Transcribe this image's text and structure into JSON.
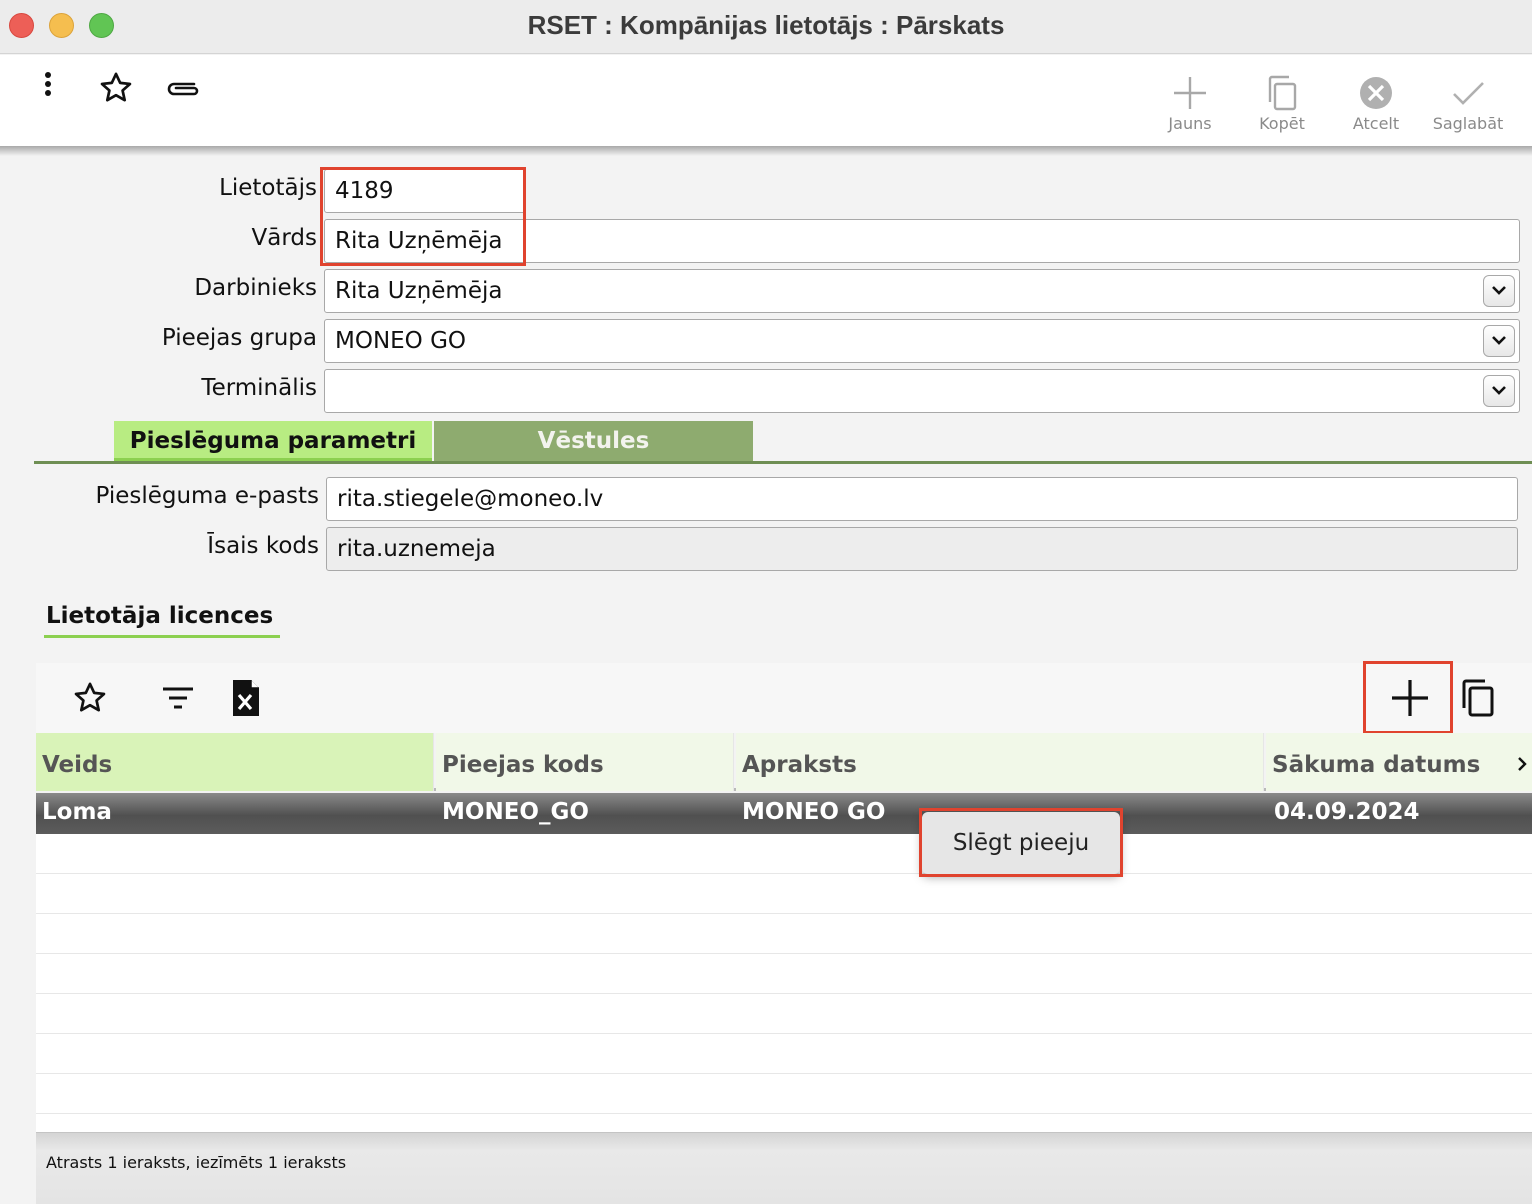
{
  "window": {
    "title": "RSET : Kompānijas lietotājs : Pārskats"
  },
  "toolbar": {
    "left_icons": [
      "more-vertical-icon",
      "star-icon",
      "paperclip-icon"
    ],
    "actions": [
      {
        "label": "Jauns",
        "icon": "plus-icon"
      },
      {
        "label": "Kopēt",
        "icon": "copy-icon"
      },
      {
        "label": "Atcelt",
        "icon": "cancel-circle-icon"
      },
      {
        "label": "Saglabāt",
        "icon": "checkmark-icon"
      }
    ]
  },
  "form": {
    "user_label": "Lietotājs",
    "user_value": "4189",
    "name_label": "Vārds",
    "name_value": "Rita Uzņēmēja",
    "employee_label": "Darbinieks",
    "employee_value": "Rita Uzņēmēja",
    "access_group_label": "Pieejas grupa",
    "access_group_value": "MONEO GO",
    "terminal_label": "Terminālis",
    "terminal_value": ""
  },
  "tabs": [
    {
      "label": "Pieslēguma parametri",
      "active": true
    },
    {
      "label": "Vēstules",
      "active": false
    }
  ],
  "connection": {
    "email_label": "Pieslēguma e-pasts",
    "email_value": "rita.stiegele@moneo.lv",
    "short_code_label": "Īsais kods",
    "short_code_value": "rita.uznemeja"
  },
  "licenses": {
    "section_title": "Lietotāja licences",
    "toolbar_icons": [
      "star-icon",
      "filter-icon",
      "excel-export-icon",
      "add-icon",
      "copy-icon"
    ],
    "columns": [
      "Veids",
      "Pieejas kods",
      "Apraksts",
      "Sākuma datums"
    ],
    "rows": [
      {
        "type": "Loma",
        "access_code": "MONEO_GO",
        "description": "MONEO GO",
        "start_date": "04.09.2024"
      }
    ]
  },
  "context_menu": {
    "items": [
      "Slēgt pieeju"
    ]
  },
  "status": {
    "text": "Atrasts 1 ieraksts, iezīmēts 1 ieraksts"
  },
  "colors": {
    "active_tab": "#b8ec82",
    "inactive_tab": "#8eab6f",
    "highlight_box": "#e0432e",
    "selected_row": "#5a5a5a"
  }
}
